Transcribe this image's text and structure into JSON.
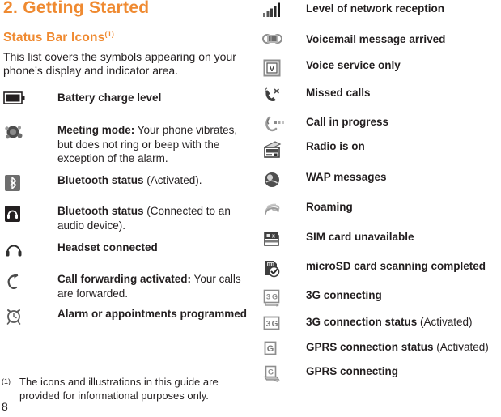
{
  "page": {
    "chapter_title": "2. Getting Started",
    "section_title": "Status Bar Icons",
    "section_title_footnote_mark": "(1)",
    "intro": "This list covers the symbols appearing on your phone’s display and indicator area.",
    "page_number": "8",
    "accent_color": "#ef8a31",
    "text_color": "#231f20",
    "background_color": "#ffffff"
  },
  "footnote": {
    "mark": "(1)",
    "text": "The icons and illustrations in this guide are provided for informational purposes only."
  },
  "left_column": {
    "items": [
      {
        "icon": "battery-charge-icon",
        "bold": "Battery charge level",
        "normal": ""
      },
      {
        "icon": "meeting-mode-vibrate-icon",
        "bold": "Meeting mode:",
        "normal": " Your phone vibrates, but does not ring or beep with the exception of the alarm."
      },
      {
        "icon": "bluetooth-activated-icon",
        "bold": "Bluetooth status",
        "normal": " (Activated)."
      },
      {
        "icon": "bluetooth-audio-connected-icon",
        "bold": "Bluetooth status",
        "normal": " (Connected to an audio device)."
      },
      {
        "icon": "headset-connected-icon",
        "bold": "Headset connected",
        "normal": ""
      },
      {
        "icon": "call-forwarding-icon",
        "bold": "Call forwarding activated:",
        "normal": " Your calls are forwarded."
      },
      {
        "icon": "alarm-clock-icon",
        "bold": "Alarm or appointments programmed",
        "normal": ""
      }
    ]
  },
  "right_column": {
    "items": [
      {
        "icon": "network-signal-bars-icon",
        "bold": "Level of network reception",
        "normal": ""
      },
      {
        "icon": "voicemail-icon",
        "bold": "Voicemail message arrived",
        "normal": ""
      },
      {
        "icon": "voice-service-only-icon",
        "bold": "Voice service only",
        "normal": ""
      },
      {
        "icon": "missed-calls-icon",
        "bold": "Missed calls",
        "normal": ""
      },
      {
        "icon": "call-in-progress-icon",
        "bold": "Call in progress",
        "normal": ""
      },
      {
        "icon": "radio-on-icon",
        "bold": "Radio is on",
        "normal": ""
      },
      {
        "icon": "wap-messages-icon",
        "bold": "WAP messages",
        "normal": ""
      },
      {
        "icon": "roaming-icon",
        "bold": "Roaming",
        "normal": ""
      },
      {
        "icon": "sim-card-unavailable-icon",
        "bold": "SIM card unavailable",
        "normal": ""
      },
      {
        "icon": "microsd-scan-complete-icon",
        "bold": "microSD card scanning completed",
        "normal": ""
      },
      {
        "icon": "3g-connecting-icon",
        "bold": "3G connecting",
        "normal": ""
      },
      {
        "icon": "3g-connection-status-icon",
        "bold": "3G connection status",
        "normal": " (Activated)"
      },
      {
        "icon": "gprs-connection-status-icon",
        "bold": "GPRS connection status",
        "normal": " (Activated)"
      },
      {
        "icon": "gprs-connecting-icon",
        "bold": "GPRS connecting",
        "normal": ""
      }
    ]
  }
}
